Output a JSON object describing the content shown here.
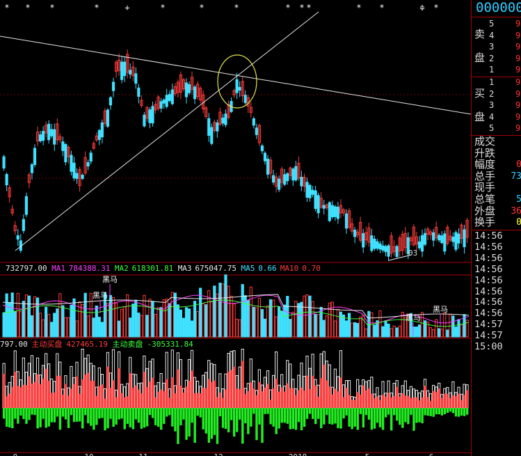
{
  "header_markers": {
    "symbols": [
      "*",
      "*",
      "*",
      "*",
      "+",
      "*",
      "*",
      "*",
      "**",
      "*",
      "*",
      "≑",
      "*"
    ]
  },
  "side_panel": {
    "stock_code": "000000",
    "sell_side_label": [
      "卖",
      "盘"
    ],
    "buy_side_label": [
      "买",
      "盘"
    ],
    "sell_levels": [
      {
        "level": "5",
        "price": "9"
      },
      {
        "level": "4",
        "price": "9"
      },
      {
        "level": "3",
        "price": "9"
      },
      {
        "level": "2",
        "price": "9"
      },
      {
        "level": "1",
        "price": "9"
      }
    ],
    "buy_levels": [
      {
        "level": "1",
        "price": "9"
      },
      {
        "level": "2",
        "price": "9"
      },
      {
        "level": "3",
        "price": "9"
      },
      {
        "level": "4",
        "price": "9"
      },
      {
        "level": "5",
        "price": "9"
      }
    ],
    "info": [
      {
        "label": "成交",
        "value": "",
        "color": "#ddd"
      },
      {
        "label": "升跌",
        "value": "",
        "color": "#ddd"
      },
      {
        "label": "幅度",
        "value": "0",
        "color": "#f33"
      },
      {
        "label": "总手",
        "value": "73",
        "color": "#3cf"
      },
      {
        "label": "现手",
        "value": "",
        "color": "#ddd"
      },
      {
        "label": "总笔",
        "value": "5",
        "color": "#3cf"
      },
      {
        "label": "外盘",
        "value": "36",
        "color": "#f33"
      },
      {
        "label": "换手",
        "value": "0",
        "color": "#ff3"
      }
    ],
    "tick_times": [
      "14:56",
      "14:56",
      "14:56",
      "14:56",
      "14:56",
      "14:56",
      "14:56",
      "14:56",
      "14:57",
      "14:57",
      "15:00"
    ]
  },
  "price_panel": {
    "low_label": "03",
    "colors": {
      "up": "#ff3b3b",
      "down": "#40e0ff",
      "trendline": "#e8e8e8",
      "circle": "#e8e850"
    }
  },
  "volume_indicator": {
    "items": [
      {
        "text": "732797.00",
        "color": "#e8e8e8"
      },
      {
        "text": "MA1",
        "color": "#ff40ff"
      },
      {
        "text": "784388.31",
        "color": "#ff40ff"
      },
      {
        "text": "MA2",
        "color": "#40ff40"
      },
      {
        "text": "618301.81",
        "color": "#40ff40"
      },
      {
        "text": "MA3",
        "color": "#e8e8e8"
      },
      {
        "text": "675047.75",
        "color": "#e8e8e8"
      },
      {
        "text": "MA5",
        "color": "#40e0ff"
      },
      {
        "text": "0.66",
        "color": "#40e0ff"
      },
      {
        "text": "MA10",
        "color": "#ff3b3b"
      },
      {
        "text": "0.70",
        "color": "#ff3b3b"
      }
    ],
    "heima_labels": [
      "黑马",
      "黑马",
      "黑马",
      "黑马"
    ]
  },
  "flow_indicator": {
    "items": [
      {
        "text": "797.00",
        "color": "#e8e8e8"
      },
      {
        "text": "主动买盘",
        "color": "#ff3b3b"
      },
      {
        "text": "427465.19",
        "color": "#ff3b3b"
      },
      {
        "text": "主动卖盘",
        "color": "#40ff40"
      },
      {
        "text": "-305331.84",
        "color": "#40ff40"
      }
    ]
  },
  "x_axis_labels": [
    "9",
    "10",
    "11",
    "12",
    "2018",
    "5",
    "6"
  ]
}
